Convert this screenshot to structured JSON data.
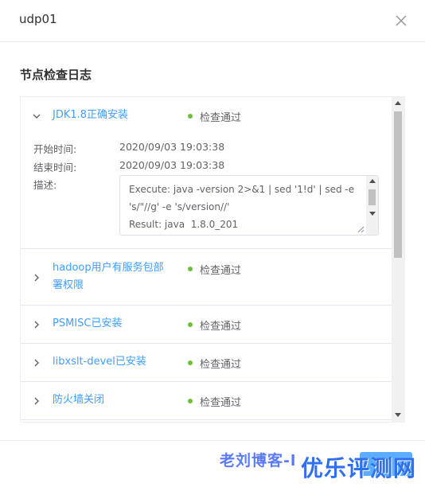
{
  "dialog": {
    "title": "udp01",
    "close_icon": "close-icon"
  },
  "section": {
    "title": "节点检查日志"
  },
  "items": [
    {
      "name": "JDK1.8正确安装",
      "status": "检查通过",
      "expanded": true,
      "details": {
        "start_label": "开始时间:",
        "start_value": "2020/09/03 19:03:38",
        "end_label": "结束时间:",
        "end_value": "2020/09/03 19:03:38",
        "desc_label": "描述:",
        "desc_value": "Execute: java -version 2>&1 | sed '1!d' | sed -e 's/\"//g' -e 's/version//'\nResult: java  1.8.0_201"
      }
    },
    {
      "name": "hadoop用户有服务包部署权限",
      "status": "检查通过",
      "expanded": false
    },
    {
      "name": "PSMISC已安装",
      "status": "检查通过",
      "expanded": false
    },
    {
      "name": "libxslt-devel已安装",
      "status": "检查通过",
      "expanded": false
    },
    {
      "name": "防火墙关闭",
      "status": "检查通过",
      "expanded": false
    }
  ],
  "watermarks": {
    "blog": "老刘博客-l",
    "site": "优乐评测网"
  },
  "colors": {
    "link": "#409eff",
    "success": "#67c23a",
    "text": "#606266"
  }
}
